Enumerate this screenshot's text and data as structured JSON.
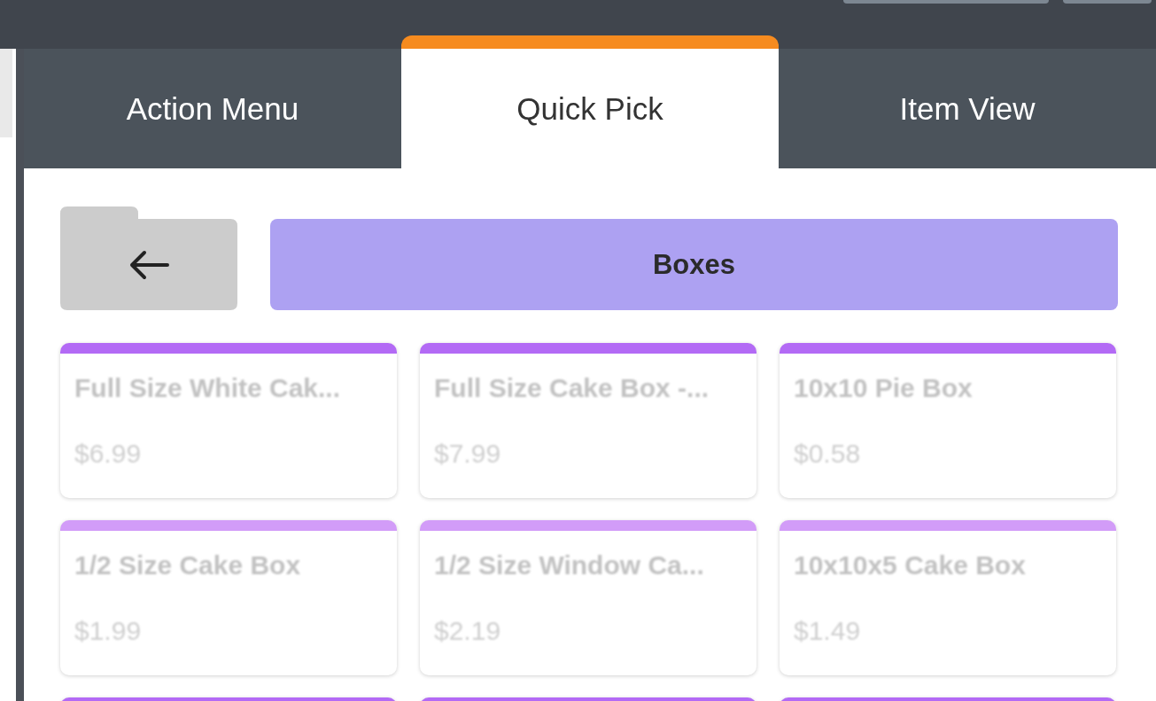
{
  "tabs": [
    {
      "label": "Action Menu",
      "selected": false
    },
    {
      "label": "Quick Pick",
      "selected": true
    },
    {
      "label": "Item View",
      "selected": false
    }
  ],
  "category": {
    "title": "Boxes",
    "color": "#ada1f2"
  },
  "items": [
    {
      "name": "Full Size White Cak...",
      "price": "$6.99",
      "color": "#b36af5"
    },
    {
      "name": "Full Size Cake Box -...",
      "price": "$7.99",
      "color": "#b36af5"
    },
    {
      "name": "10x10 Pie Box",
      "price": "$0.58",
      "color": "#b36af5"
    },
    {
      "name": "1/2 Size Cake Box",
      "price": "$1.99",
      "color": "#d29cf8"
    },
    {
      "name": "1/2 Size Window Ca...",
      "price": "$2.19",
      "color": "#d29cf8"
    },
    {
      "name": "10x10x5 Cake Box",
      "price": "$1.49",
      "color": "#d29cf8"
    },
    {
      "color": "#b36af5"
    },
    {
      "color": "#b36af5"
    },
    {
      "color": "#b36af5"
    }
  ]
}
